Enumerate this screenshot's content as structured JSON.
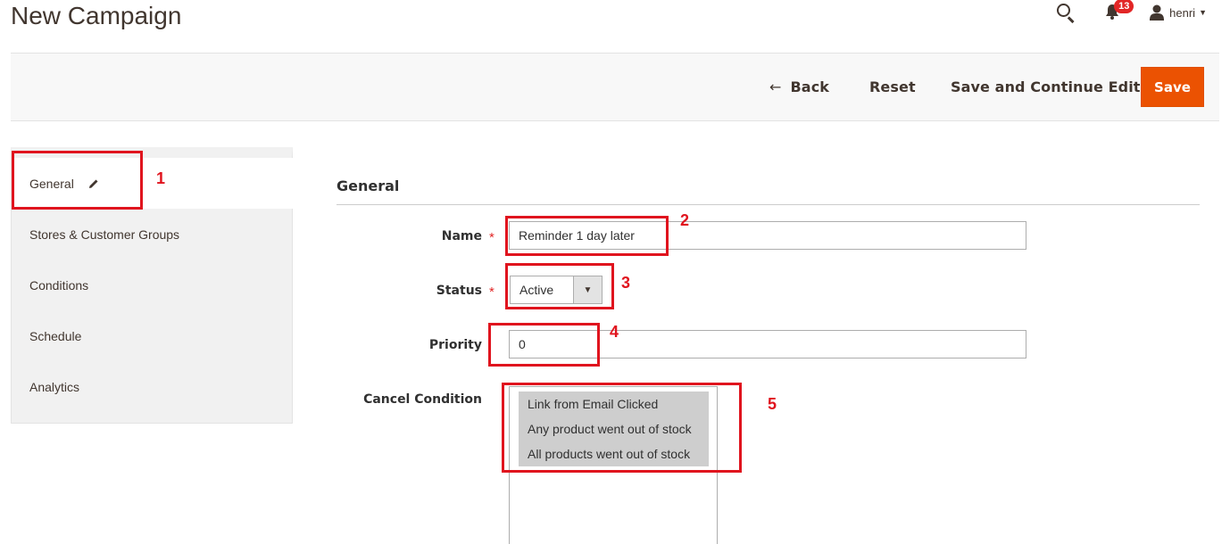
{
  "page": {
    "title": "New Campaign"
  },
  "header": {
    "notification_count": "13",
    "user_name": "henri"
  },
  "actions": {
    "back_arrow": "←",
    "back_label": "Back",
    "reset_label": "Reset",
    "save_continue_label": "Save and Continue Edit",
    "save_label": "Save"
  },
  "sidebar": {
    "items": [
      {
        "label": "General",
        "active": true
      },
      {
        "label": "Stores & Customer Groups"
      },
      {
        "label": "Conditions"
      },
      {
        "label": "Schedule"
      },
      {
        "label": "Analytics"
      }
    ]
  },
  "form": {
    "section_title": "General",
    "name": {
      "label": "Name",
      "value": "Reminder 1 day later",
      "required": true
    },
    "status": {
      "label": "Status",
      "value": "Active",
      "required": true
    },
    "priority": {
      "label": "Priority",
      "value": "0"
    },
    "cancel_condition": {
      "label": "Cancel Condition",
      "options": [
        "Link from Email Clicked",
        "Any product went out of stock",
        "All products went out of stock"
      ]
    }
  },
  "annotations": [
    "1",
    "2",
    "3",
    "4",
    "5"
  ],
  "colors": {
    "accent": "#eb5202",
    "annotation": "#e0141e",
    "badge": "#e22626"
  }
}
